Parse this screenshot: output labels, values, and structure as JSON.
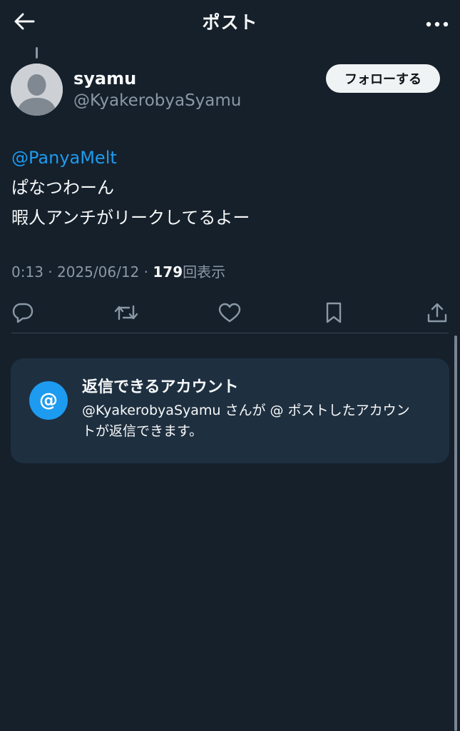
{
  "header": {
    "title": "ポスト",
    "back_icon": "arrow-left-icon",
    "more_icon": "more-dots-icon"
  },
  "author": {
    "display_name": "syamu",
    "handle": "@KyakerobyaSyamu",
    "avatar_icon": "default-avatar-icon",
    "follow_label": "フォローする"
  },
  "post": {
    "mention": "@PanyaMelt",
    "lines": [
      "ぱなつわーん",
      "暇人アンチがリークしてるよー"
    ]
  },
  "meta": {
    "time": "0:13",
    "separator": "·",
    "date": "2025/06/12",
    "views_count": "179",
    "views_label": "回表示"
  },
  "actions": [
    {
      "name": "reply-icon"
    },
    {
      "name": "repost-icon"
    },
    {
      "name": "like-icon"
    },
    {
      "name": "bookmark-icon"
    },
    {
      "name": "share-icon"
    }
  ],
  "reply_info": {
    "icon_glyph": "@",
    "title": "返信できるアカウント",
    "description": "@KyakerobyaSyamu さんが @ ポストしたアカウントが返信できます。"
  },
  "colors": {
    "background": "#15202b",
    "accent": "#1d9bf0",
    "card": "#1e2f40",
    "muted_text": "#8b98a5"
  }
}
